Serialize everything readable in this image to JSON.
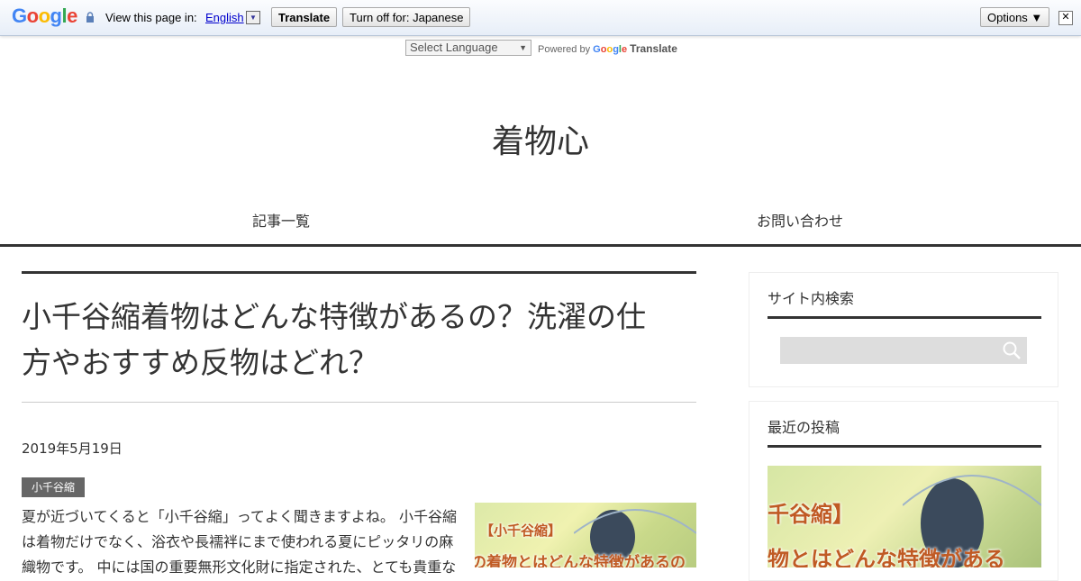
{
  "translate_bar": {
    "logo": [
      "G",
      "o",
      "o",
      "g",
      "l",
      "e"
    ],
    "view_text": "View this page in:",
    "language": "English",
    "translate_label": "Translate",
    "turn_off_label": "Turn off for: Japanese",
    "options_label": "Options ▼",
    "close_glyph": "✕"
  },
  "language_widget": {
    "select_label": "Select Language",
    "powered_by": "Powered by",
    "google_word": [
      "G",
      "o",
      "o",
      "g",
      "l",
      "e"
    ],
    "translate_word": "Translate"
  },
  "site": {
    "title": "着物心",
    "nav": [
      "記事一覧",
      "お問い合わせ"
    ]
  },
  "article": {
    "title_line1": "小千谷縮着物はどんな特徴があるの？洗濯の仕",
    "title_line2": "方やおすすめ反物はどれ？",
    "date": "2019年5月19日",
    "category": "小千谷縮",
    "body_lines": [
      "夏が近づいてくると「小千谷縮」ってよく聞きますよね。 小千谷縮",
      "は着物だけでなく、浴衣や長襦袢にまで使われる夏にピッタリの麻",
      "織物です。 中には国の重要無形文化財に指定された、とても貴重な"
    ],
    "thumbnail_text": [
      "【小千谷縮】",
      "の着物とはどんな特徴があるの"
    ]
  },
  "sidebar": {
    "search_title": "サイト内検索",
    "recent_title": "最近の投稿",
    "recent_thumb_text": [
      "千谷縮】",
      "物とはどんな特徴がある"
    ]
  },
  "colors": {
    "accent_rule": "#333333",
    "badge_bg": "#666666",
    "thumb_text": "#c05a24",
    "link": "#0000cc"
  }
}
